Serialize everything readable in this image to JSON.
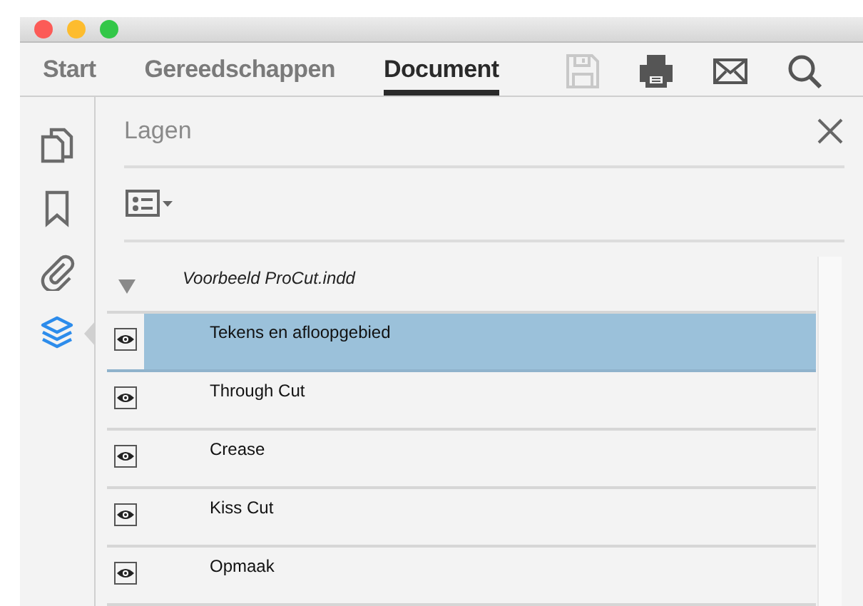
{
  "toolbar": {
    "tabs": [
      {
        "label": "Start",
        "selected": false
      },
      {
        "label": "Gereedschappen",
        "selected": false
      },
      {
        "label": "Document",
        "selected": true
      }
    ],
    "actions": [
      {
        "kind": "save",
        "disabled": true
      },
      {
        "kind": "print",
        "disabled": false
      },
      {
        "kind": "mail",
        "disabled": false
      },
      {
        "kind": "search",
        "disabled": false
      }
    ]
  },
  "sidebar": {
    "items": [
      {
        "kind": "pages",
        "selected": false
      },
      {
        "kind": "bookmarks",
        "selected": false
      },
      {
        "kind": "attachments",
        "selected": false
      },
      {
        "kind": "layers",
        "selected": true
      }
    ]
  },
  "panel": {
    "title": "Lagen",
    "tree": {
      "label": "Voorbeeld ProCut.indd",
      "expanded": true,
      "children": [
        {
          "label": "Tekens en afloopgebied",
          "visible": true,
          "selected": true
        },
        {
          "label": "Through Cut",
          "visible": true,
          "selected": false
        },
        {
          "label": "Crease",
          "visible": true,
          "selected": false
        },
        {
          "label": "Kiss Cut",
          "visible": true,
          "selected": false
        },
        {
          "label": "Opmaak",
          "visible": true,
          "selected": false
        }
      ]
    }
  }
}
